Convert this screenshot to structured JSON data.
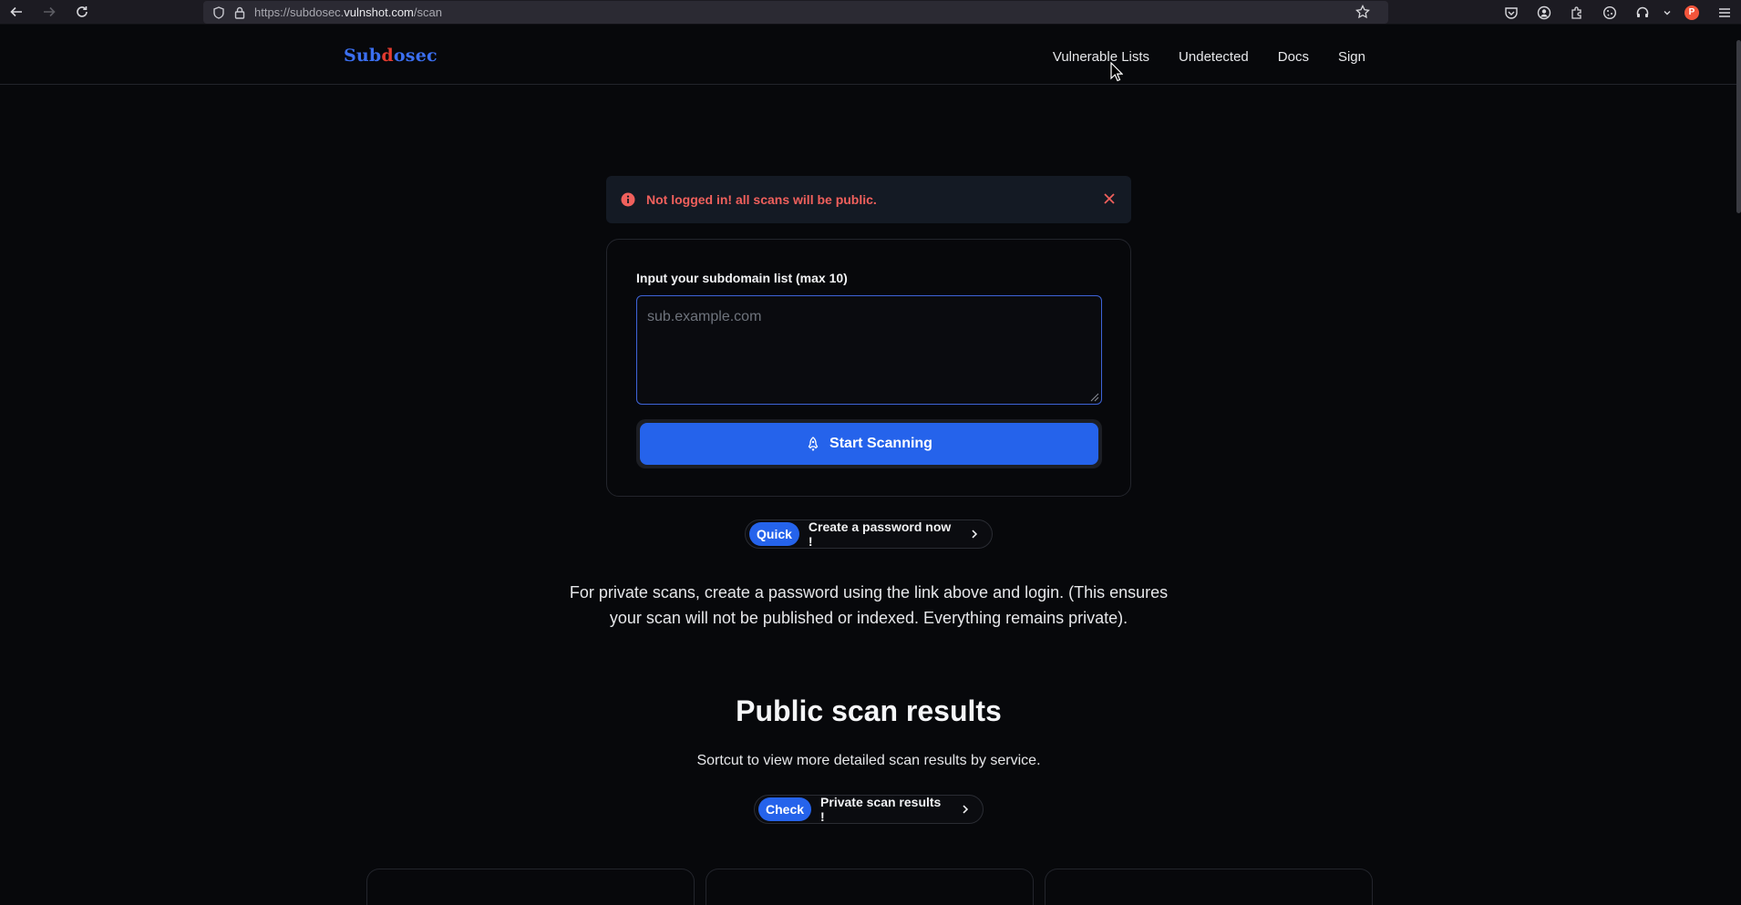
{
  "browser": {
    "url_prefix": "https://subdosec.",
    "url_host": "vulnshot.com",
    "url_path": "/scan"
  },
  "site": {
    "logo_part1": "Sub",
    "logo_part2": "d",
    "logo_part3": "osec",
    "nav": [
      {
        "label": "Vulnerable Lists"
      },
      {
        "label": "Undetected"
      },
      {
        "label": "Docs"
      },
      {
        "label": "Sign"
      }
    ]
  },
  "alert": {
    "message": "Not logged in! all scans will be public."
  },
  "scan_form": {
    "label": "Input your subdomain list (max 10)",
    "placeholder": "sub.example.com",
    "value": "",
    "button_label": "Start Scanning"
  },
  "quick_link": {
    "tag": "Quick",
    "text": "Create a password now !"
  },
  "info": {
    "paragraph": "For private scans, create a password using the link above and login. (This ensures your scan will not be published or indexed. Everything remains private)."
  },
  "results": {
    "title": "Public scan results",
    "subtitle": "Sortcut to view more detailed scan results by service.",
    "check_tag": "Check",
    "check_text": "Private scan results !"
  },
  "colors": {
    "accent": "#2563eb",
    "alert_text": "#f0605c",
    "logo_blue": "#3b6ff0",
    "logo_red": "#e33b2f"
  }
}
